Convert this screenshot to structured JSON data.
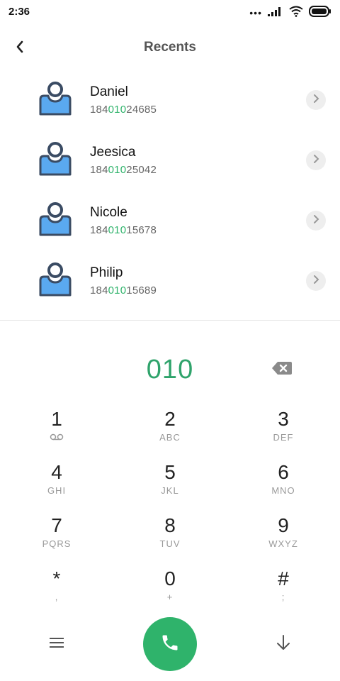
{
  "status": {
    "time": "2:36",
    "dots": "•••",
    "icons": [
      "signal-icon",
      "wifi-icon",
      "battery-icon"
    ]
  },
  "header": {
    "title": "Recents",
    "back_icon": "chevron-left-icon"
  },
  "recents": [
    {
      "name": "Daniel",
      "number_prefix": "184",
      "number_match": "010",
      "number_suffix": "24685"
    },
    {
      "name": "Jeesica",
      "number_prefix": "184",
      "number_match": "010",
      "number_suffix": "25042"
    },
    {
      "name": "Nicole",
      "number_prefix": "184",
      "number_match": "010",
      "number_suffix": "15678"
    },
    {
      "name": "Philip",
      "number_prefix": "184",
      "number_match": "010",
      "number_suffix": "15689"
    }
  ],
  "dialer": {
    "input_value": "010",
    "backspace_icon": "backspace-icon"
  },
  "keypad": [
    {
      "digit": "1",
      "letters": ""
    },
    {
      "digit": "2",
      "letters": "ABC"
    },
    {
      "digit": "3",
      "letters": "DEF"
    },
    {
      "digit": "4",
      "letters": "GHI"
    },
    {
      "digit": "5",
      "letters": "JKL"
    },
    {
      "digit": "6",
      "letters": "MNO"
    },
    {
      "digit": "7",
      "letters": "PQRS"
    },
    {
      "digit": "8",
      "letters": "TUV"
    },
    {
      "digit": "9",
      "letters": "WXYZ"
    },
    {
      "digit": "*",
      "letters": ","
    },
    {
      "digit": "0",
      "letters": "+"
    },
    {
      "digit": "#",
      "letters": ";"
    }
  ],
  "bottom": {
    "menu_icon": "menu-icon",
    "call_icon": "phone-icon",
    "hide_icon": "arrow-down-icon"
  },
  "colors": {
    "accent": "#2fb36b",
    "avatar_body": "#5aa9f0",
    "avatar_outline": "#3a4b63"
  }
}
